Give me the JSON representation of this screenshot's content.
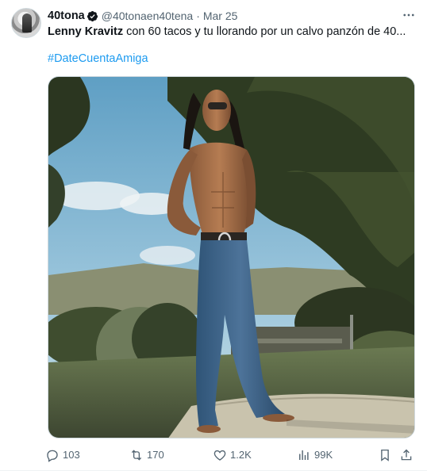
{
  "author": {
    "display_name": "40tona",
    "handle": "@40tonaen40tena",
    "separator": "·",
    "date": "Mar 25"
  },
  "tweet": {
    "text_bold": "Lenny Kravitz",
    "text_rest": " con 60 tacos y tu llorando por un calvo panzón de 40...",
    "hashtag": "#DateCuentaAmiga"
  },
  "metrics": {
    "replies": "103",
    "reposts": "170",
    "likes": "1.2K",
    "views": "99K"
  },
  "colors": {
    "link": "#1d9bf0",
    "secondary": "#536471",
    "text": "#0f1419"
  },
  "icons": [
    "verified-icon",
    "more-icon",
    "reply-icon",
    "repost-icon",
    "like-icon",
    "views-icon",
    "bookmark-icon",
    "share-icon"
  ]
}
